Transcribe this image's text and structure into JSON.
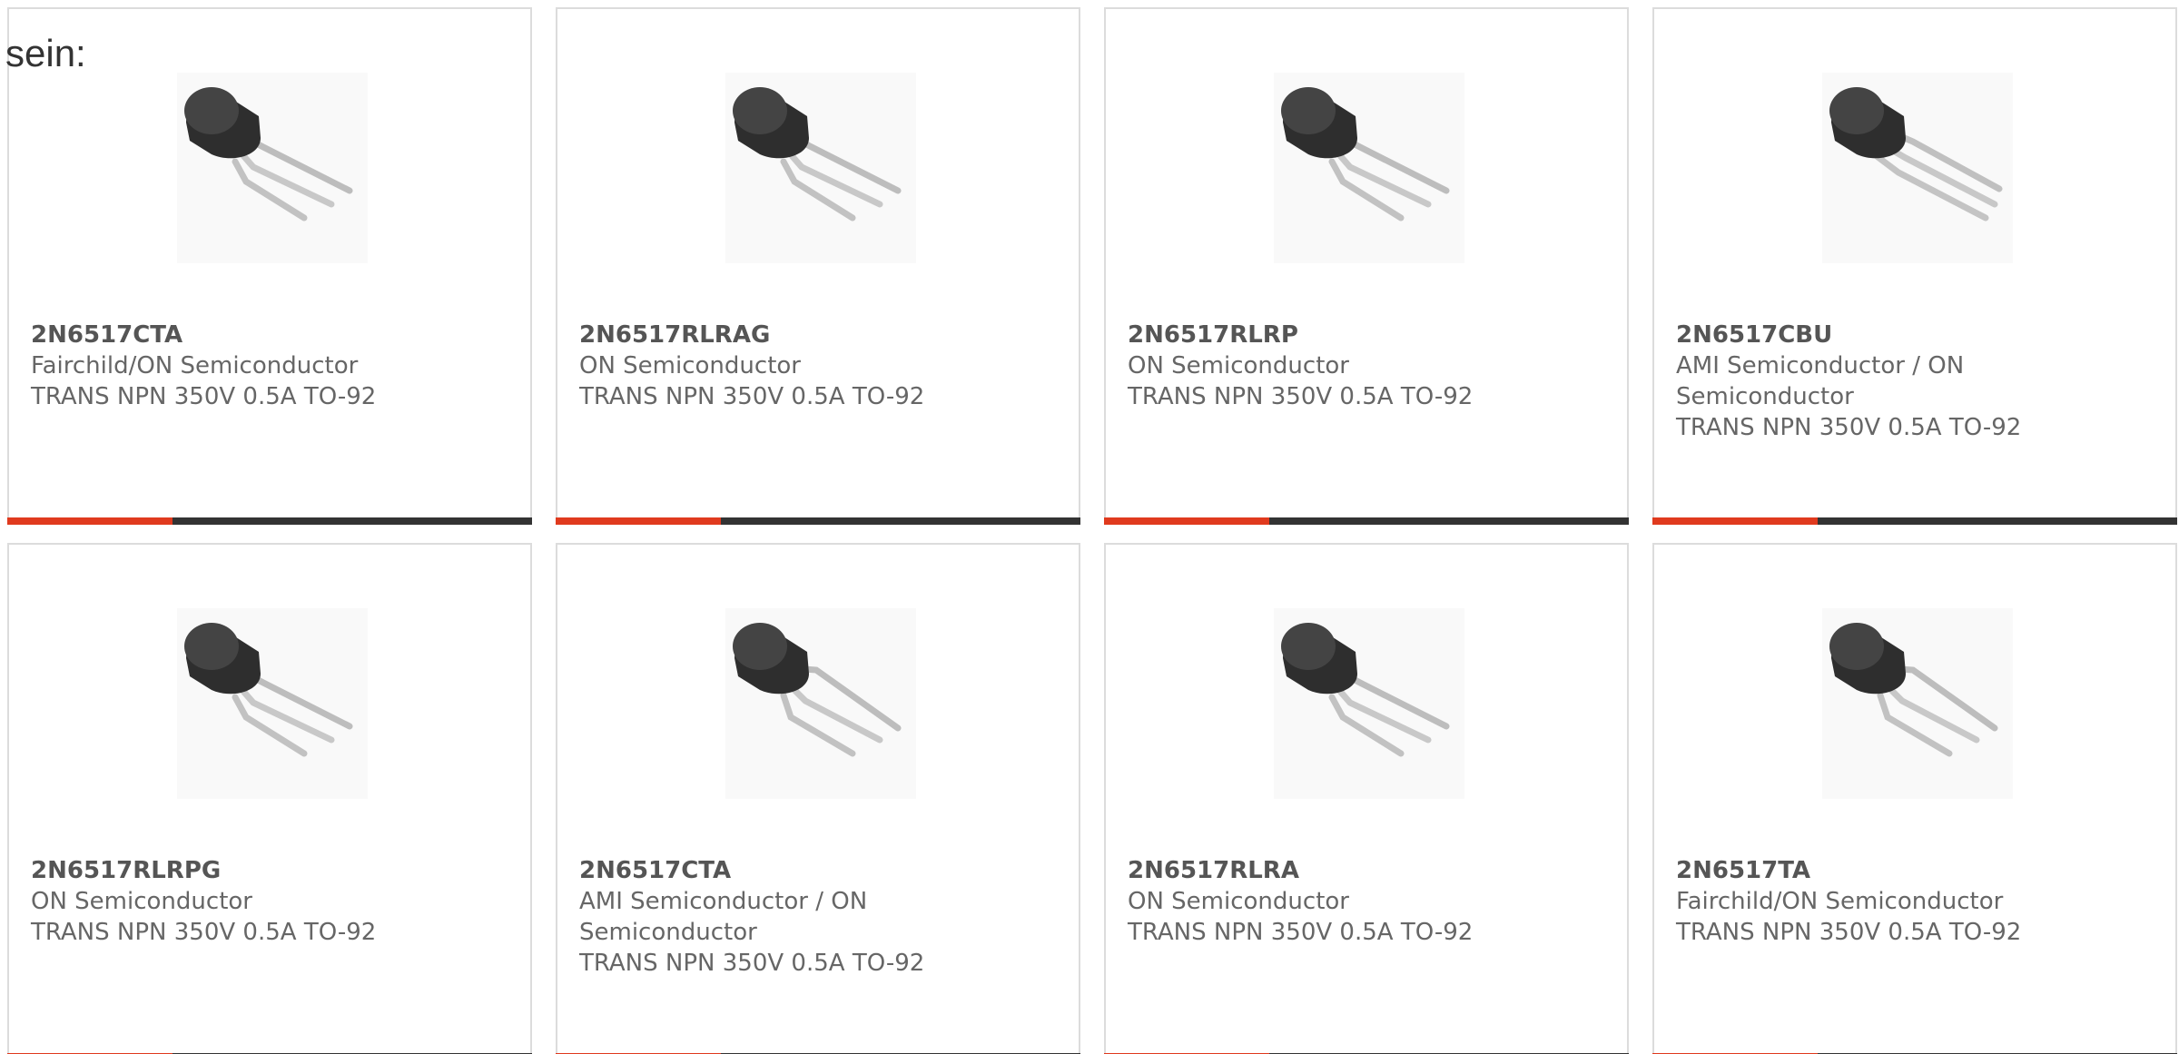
{
  "intro_text": "sein:",
  "accent_color": "#e03a1e",
  "bar_color": "#333333",
  "products": [
    {
      "part": "2N6517CTA",
      "manufacturer": "Fairchild/ON Semiconductor",
      "description": "TRANS NPN 350V 0.5A TO-92",
      "image": "to92-transistor"
    },
    {
      "part": "2N6517RLRAG",
      "manufacturer": "ON Semiconductor",
      "description": "TRANS NPN 350V 0.5A TO-92",
      "image": "to92-transistor"
    },
    {
      "part": "2N6517RLRP",
      "manufacturer": "ON Semiconductor",
      "description": "TRANS NPN 350V 0.5A TO-92",
      "image": "to92-transistor"
    },
    {
      "part": "2N6517CBU",
      "manufacturer": "AMI Semiconductor / ON Semiconductor",
      "description": "TRANS NPN 350V 0.5A TO-92",
      "image": "to92-transistor"
    },
    {
      "part": "2N6517RLRPG",
      "manufacturer": "ON Semiconductor",
      "description": "TRANS NPN 350V 0.5A TO-92",
      "image": "to92-transistor"
    },
    {
      "part": "2N6517CTA",
      "manufacturer": "AMI Semiconductor / ON Semiconductor",
      "description": "TRANS NPN 350V 0.5A TO-92",
      "image": "to92-transistor"
    },
    {
      "part": "2N6517RLRA",
      "manufacturer": "ON Semiconductor",
      "description": "TRANS NPN 350V 0.5A TO-92",
      "image": "to92-transistor"
    },
    {
      "part": "2N6517TA",
      "manufacturer": "Fairchild/ON Semiconductor",
      "description": "TRANS NPN 350V 0.5A TO-92",
      "image": "to92-transistor"
    }
  ]
}
